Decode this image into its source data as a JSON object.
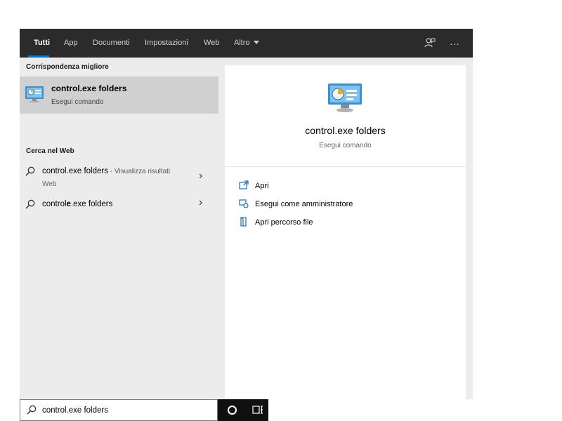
{
  "tabs": {
    "items": [
      {
        "label": "Tutti",
        "active": true
      },
      {
        "label": "App"
      },
      {
        "label": "Documenti"
      },
      {
        "label": "Impostazioni"
      },
      {
        "label": "Web"
      },
      {
        "label": "Altro"
      }
    ],
    "feedback_icon": "feedback-icon",
    "more_icon": "ellipsis-icon",
    "more_glyph": "···"
  },
  "left": {
    "best_match_heading": "Corrispondenza migliore",
    "best_match": {
      "title": "control.exe folders",
      "subtitle": "Esegui comando",
      "icon": "control-panel-icon"
    },
    "web_heading": "Cerca nel Web",
    "web_results": [
      {
        "main": "control.exe folders",
        "suffix": " - Visualizza risultati",
        "sub": "Web"
      },
      {
        "main_prefix": "control",
        "main_bold": "e",
        "main_rest": ".exe folders"
      }
    ]
  },
  "right": {
    "title": "control.exe folders",
    "subtitle": "Esegui comando",
    "actions": [
      {
        "label": "Apri",
        "icon": "open-icon"
      },
      {
        "label": "Esegui come amministratore",
        "icon": "run-as-admin-icon"
      },
      {
        "label": "Apri percorso file",
        "icon": "file-location-icon"
      }
    ]
  },
  "searchbar": {
    "value": "control.exe folders",
    "icon": "search-icon"
  },
  "taskbar": {
    "cortana_icon": "cortana-icon",
    "taskview_icon": "task-view-icon"
  },
  "colors": {
    "tabbar_bg": "#2b2b2b",
    "accent": "#0078d7",
    "panel_bg": "#ececec",
    "selected_bg": "#d0d0d0",
    "taskbar_bg": "#101010"
  }
}
